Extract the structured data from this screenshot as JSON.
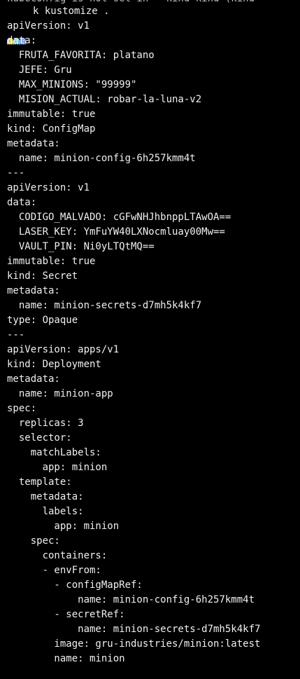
{
  "top_partial": "kubeconfig is not set in ~ kind kind (kind",
  "colors": {
    "background": "#000000",
    "text": "#f0f0f0",
    "ghost_yellow": "#f2d64b",
    "ghost_cyan": "#5fd7e8",
    "ghost_blue": "#7aa6ff"
  },
  "icons": [
    "pacman-ghost-yellow-icon",
    "pacman-ghost-cyan-icon",
    "pacman-ghost-blue-icon"
  ],
  "prompt": {
    "command": "k kustomize ."
  },
  "output": [
    "apiVersion: v1",
    "data:",
    "  FRUTA_FAVORITA: platano",
    "  JEFE: Gru",
    "  MAX_MINIONS: \"99999\"",
    "  MISION_ACTUAL: robar-la-luna-v2",
    "immutable: true",
    "kind: ConfigMap",
    "metadata:",
    "  name: minion-config-6h257kmm4t",
    "---",
    "apiVersion: v1",
    "data:",
    "  CODIGO_MALVADO: cGFwNHJhbnppLTAwOA==",
    "  LASER_KEY: YmFuYW40LXNocmluay00Mw==",
    "  VAULT_PIN: Ni0yLTQtMQ==",
    "immutable: true",
    "kind: Secret",
    "metadata:",
    "  name: minion-secrets-d7mh5k4kf7",
    "type: Opaque",
    "---",
    "apiVersion: apps/v1",
    "kind: Deployment",
    "metadata:",
    "  name: minion-app",
    "spec:",
    "  replicas: 3",
    "  selector:",
    "    matchLabels:",
    "      app: minion",
    "  template:",
    "    metadata:",
    "      labels:",
    "        app: minion",
    "    spec:",
    "      containers:",
    "      - envFrom:",
    "        - configMapRef:",
    "            name: minion-config-6h257kmm4t",
    "        - secretRef:",
    "            name: minion-secrets-d7mh5k4kf7",
    "        image: gru-industries/minion:latest",
    "        name: minion"
  ]
}
